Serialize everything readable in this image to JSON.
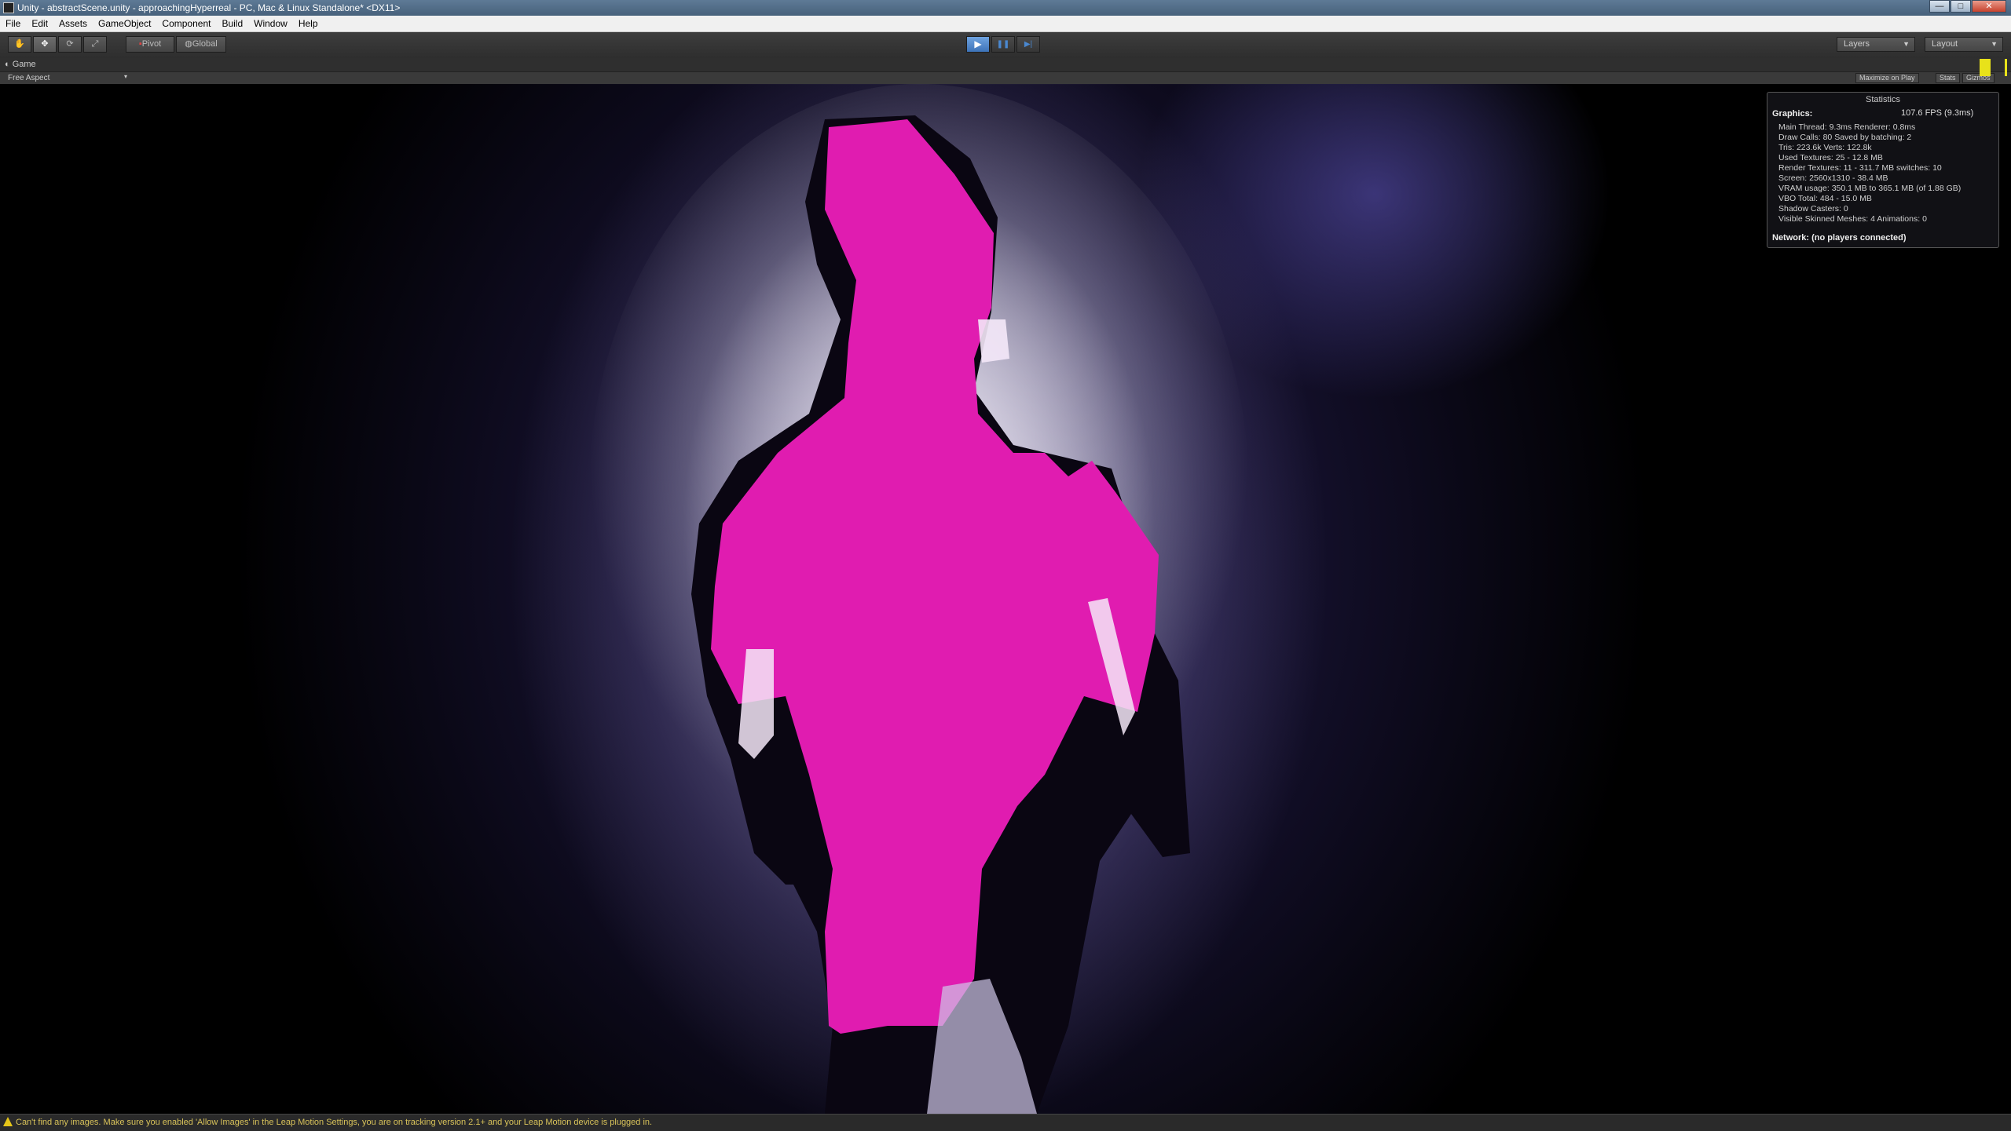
{
  "window": {
    "title": "Unity - abstractScene.unity - approachingHyperreal - PC, Mac & Linux Standalone* <DX11>",
    "buttons": {
      "minimize": "—",
      "maximize": "□",
      "close": "✕"
    }
  },
  "menu": [
    "File",
    "Edit",
    "Assets",
    "GameObject",
    "Component",
    "Build",
    "Window",
    "Help"
  ],
  "toolbar": {
    "tools": [
      "hand-icon",
      "move-icon",
      "rotate-icon",
      "scale-icon"
    ],
    "pivot_label": "Pivot",
    "global_label": "Global",
    "play": "▶",
    "pause": "❚❚",
    "step": "▶|",
    "layers_label": "Layers",
    "layout_label": "Layout"
  },
  "game_view": {
    "tab_label": "Game",
    "aspect_label": "Free Aspect",
    "maximize_on_play": "Maximize on Play",
    "stats_label": "Stats",
    "gizmos_label": "Gizmos"
  },
  "statistics": {
    "title": "Statistics",
    "graphics_label": "Graphics:",
    "fps": "107.6 FPS (9.3ms)",
    "lines": [
      "Main Thread: 9.3ms   Renderer: 0.8ms",
      "Draw Calls: 80      Saved by batching: 2",
      "Tris: 223.6k      Verts: 122.8k",
      "Used Textures: 25 - 12.8 MB",
      "Render Textures: 11 - 311.7 MB      switches: 10",
      "Screen: 2560x1310 - 38.4 MB",
      "VRAM usage: 350.1 MB to 365.1 MB (of 1.88 GB)",
      "VBO Total: 484 - 15.0 MB",
      "Shadow Casters: 0",
      "Visible Skinned Meshes: 4       Animations: 0"
    ],
    "network": "Network: (no players connected)"
  },
  "status_bar": {
    "message": "Can't find any images. Make sure you enabled 'Allow Images' in the Leap Motion Settings, you are on tracking version 2.1+ and your Leap Motion device is plugged in."
  },
  "colors": {
    "figure_magenta": "#e01cb0",
    "warning_yellow": "#e6c619",
    "play_active": "#4a88d0"
  }
}
